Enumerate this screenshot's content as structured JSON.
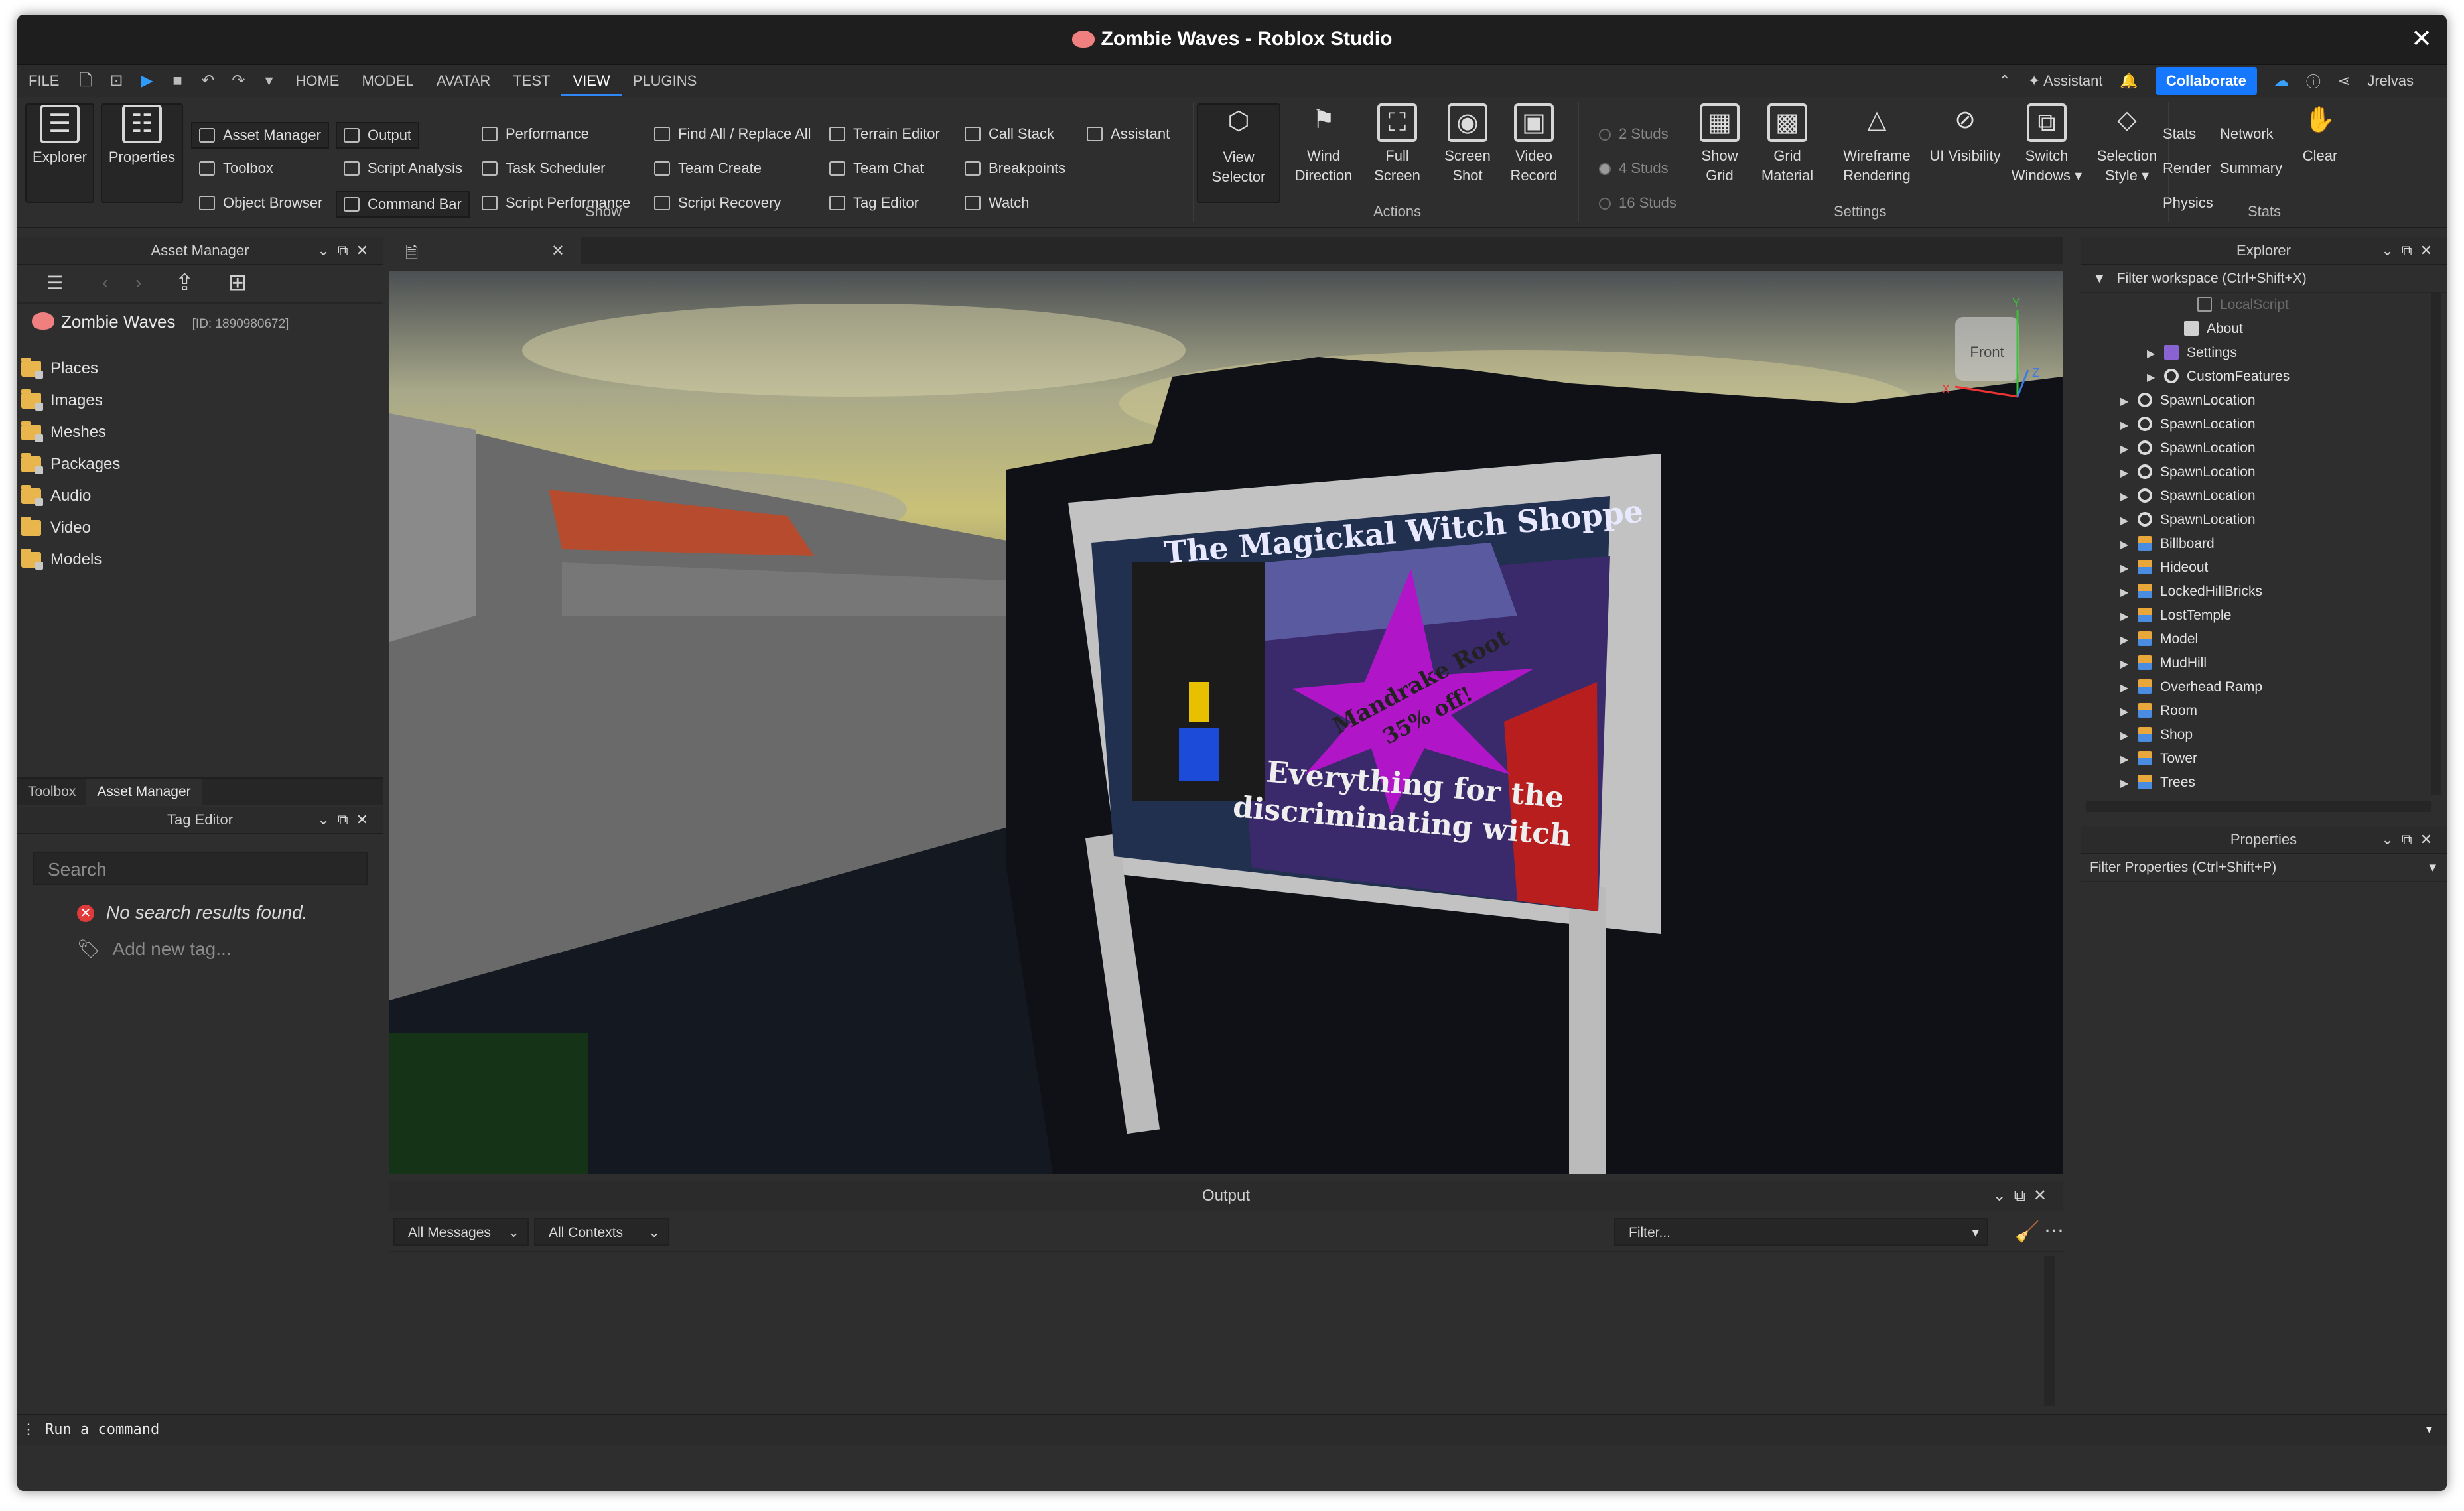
{
  "window": {
    "title": "Zombie Waves - Roblox Studio"
  },
  "menu": {
    "file": "FILE",
    "tabs": [
      "HOME",
      "MODEL",
      "AVATAR",
      "TEST",
      "VIEW",
      "PLUGINS"
    ],
    "assistant": "Assistant",
    "collaborate": "Collaborate",
    "user": "Jrelvas"
  },
  "ribbon": {
    "explorer": "Explorer",
    "properties": "Properties",
    "show": {
      "col1": [
        "Asset Manager",
        "Toolbox",
        "Object Browser"
      ],
      "col2": [
        "Output",
        "Script Analysis",
        "Command Bar"
      ],
      "col3": [
        "Performance",
        "Task Scheduler",
        "Script Performance"
      ],
      "col4": [
        "Find All / Replace All",
        "Team Create",
        "Script Recovery"
      ],
      "col5": [
        "Terrain Editor",
        "Team Chat",
        "Tag Editor"
      ],
      "col6": [
        "Call Stack",
        "Breakpoints",
        "Watch"
      ],
      "col7": [
        "Assistant"
      ],
      "group_label": "Show"
    },
    "actions": {
      "view_selector": [
        "View",
        "Selector"
      ],
      "wind_direction": [
        "Wind",
        "Direction"
      ],
      "full_screen": [
        "Full",
        "Screen"
      ],
      "screen_shot": [
        "Screen",
        "Shot"
      ],
      "video_record": [
        "Video",
        "Record"
      ],
      "group_label": "Actions"
    },
    "settings": {
      "studs": [
        "2 Studs",
        "4 Studs",
        "16 Studs"
      ],
      "show_grid": [
        "Show",
        "Grid"
      ],
      "grid_material": [
        "Grid",
        "Material"
      ],
      "wireframe": [
        "Wireframe",
        "Rendering"
      ],
      "ui_visibility": "UI Visibility",
      "switch_windows": [
        "Switch",
        "Windows ▾"
      ],
      "selection_style": [
        "Selection",
        "Style ▾"
      ],
      "group_label": "Settings"
    },
    "stats": {
      "items": [
        "Stats",
        "Network",
        "Render",
        "Summary",
        "Physics"
      ],
      "clear": "Clear",
      "group_label": "Stats"
    }
  },
  "asset_manager": {
    "header": "Asset Manager",
    "game_name": "Zombie Waves",
    "game_id": "[ID: 1890980672]",
    "folders": [
      "Places",
      "Images",
      "Meshes",
      "Packages",
      "Audio",
      "Video",
      "Models"
    ],
    "tabs": [
      "Toolbox",
      "Asset Manager"
    ]
  },
  "tag_editor": {
    "header": "Tag Editor",
    "search_placeholder": "Search",
    "no_results": "No search results found.",
    "add_new": "Add new tag..."
  },
  "viewport": {
    "sign_title": "The Magickal Witch Shoppe",
    "burst_text_1": "Mandrake Root",
    "burst_text_2": "35% off!",
    "sign_bottom_1": "Everything for the",
    "sign_bottom_2": "discriminating witch",
    "view_cube_label": "Front",
    "axis_y": "Y",
    "axis_x": "X",
    "axis_z": "Z"
  },
  "output": {
    "header": "Output",
    "messages": "All Messages",
    "contexts": "All Contexts",
    "filter_placeholder": "Filter..."
  },
  "explorer": {
    "header": "Explorer",
    "filter": "Filter workspace (Ctrl+Shift+X)",
    "items": [
      {
        "label": "LocalScript",
        "icon": "script-icon",
        "faded": true
      },
      {
        "label": "About",
        "icon": "document-icon"
      },
      {
        "label": "Settings",
        "icon": "settings-icon",
        "arrow": true
      },
      {
        "label": "CustomFeatures",
        "icon": "gear-icon",
        "arrow": true
      },
      {
        "label": "SpawnLocation",
        "icon": "gear-icon",
        "arrow": true
      },
      {
        "label": "SpawnLocation",
        "icon": "gear-icon",
        "arrow": true
      },
      {
        "label": "SpawnLocation",
        "icon": "gear-icon",
        "arrow": true
      },
      {
        "label": "SpawnLocation",
        "icon": "gear-icon",
        "arrow": true
      },
      {
        "label": "SpawnLocation",
        "icon": "gear-icon",
        "arrow": true
      },
      {
        "label": "SpawnLocation",
        "icon": "gear-icon",
        "arrow": true
      },
      {
        "label": "Billboard",
        "icon": "model-icon",
        "arrow": true
      },
      {
        "label": "Hideout",
        "icon": "model-icon",
        "arrow": true
      },
      {
        "label": "LockedHillBricks",
        "icon": "model-icon",
        "arrow": true
      },
      {
        "label": "LostTemple",
        "icon": "model-icon",
        "arrow": true
      },
      {
        "label": "Model",
        "icon": "model-icon",
        "arrow": true
      },
      {
        "label": "MudHill",
        "icon": "model-icon",
        "arrow": true
      },
      {
        "label": "Overhead Ramp",
        "icon": "model-icon",
        "arrow": true
      },
      {
        "label": "Room",
        "icon": "model-icon",
        "arrow": true
      },
      {
        "label": "Shop",
        "icon": "model-icon",
        "arrow": true
      },
      {
        "label": "Tower",
        "icon": "model-icon",
        "arrow": true
      },
      {
        "label": "Trees",
        "icon": "model-icon",
        "arrow": true
      }
    ]
  },
  "properties": {
    "header": "Properties",
    "filter": "Filter Properties (Ctrl+Shift+P)"
  },
  "command_bar": {
    "placeholder": "Run a command"
  },
  "colors": {
    "accent": "#1677ff",
    "panel": "#2e2e2e",
    "titlebar": "#1e1e1e"
  }
}
